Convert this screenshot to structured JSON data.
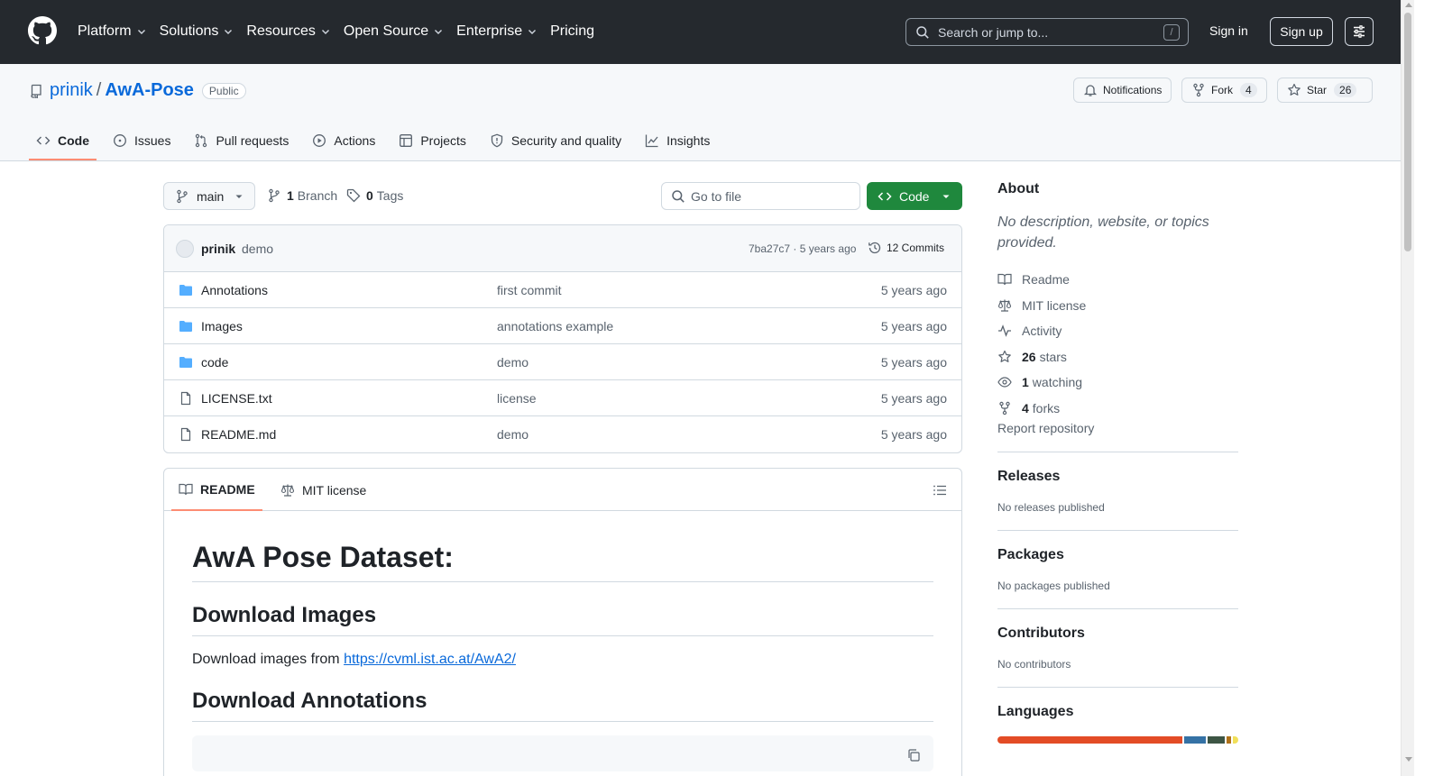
{
  "header": {
    "nav": [
      {
        "label": "Platform",
        "has_menu": true
      },
      {
        "label": "Solutions",
        "has_menu": true
      },
      {
        "label": "Resources",
        "has_menu": true
      },
      {
        "label": "Open Source",
        "has_menu": true
      },
      {
        "label": "Enterprise",
        "has_menu": true
      },
      {
        "label": "Pricing",
        "has_menu": false
      }
    ],
    "search_placeholder": "Search or jump to...",
    "search_shortcut": "/",
    "sign_in": "Sign in",
    "sign_up": "Sign up"
  },
  "repo": {
    "owner": "prinik",
    "separator": "/",
    "name": "AwA-Pose",
    "visibility": "Public",
    "notifications_label": "Notifications",
    "fork_label": "Fork",
    "fork_count": "4",
    "star_label": "Star",
    "star_count": "26",
    "tabs": [
      {
        "label": "Code",
        "icon": "code-icon",
        "active": true
      },
      {
        "label": "Issues",
        "icon": "issue-icon",
        "active": false
      },
      {
        "label": "Pull requests",
        "icon": "pull-request-icon",
        "active": false
      },
      {
        "label": "Actions",
        "icon": "play-icon",
        "active": false
      },
      {
        "label": "Projects",
        "icon": "table-icon",
        "active": false
      },
      {
        "label": "Security and quality",
        "icon": "shield-icon",
        "active": false
      },
      {
        "label": "Insights",
        "icon": "graph-icon",
        "active": false
      }
    ]
  },
  "browser": {
    "branch": "main",
    "branches_count": "1",
    "branches_label": "Branch",
    "tags_count": "0",
    "tags_label": "Tags",
    "go_to_file": "Go to file",
    "code_button": "Code",
    "commit": {
      "author": "prinik",
      "message": "demo",
      "hash_time": "7ba27c7 · 5 years ago",
      "commits_label": "12 Commits"
    },
    "files": [
      {
        "name": "Annotations",
        "type": "folder",
        "message": "first commit",
        "date": "5 years ago"
      },
      {
        "name": "Images",
        "type": "folder",
        "message": "annotations example",
        "date": "5 years ago"
      },
      {
        "name": "code",
        "type": "folder",
        "message": "demo",
        "date": "5 years ago"
      },
      {
        "name": "LICENSE.txt",
        "type": "file",
        "message": "license",
        "date": "5 years ago"
      },
      {
        "name": "README.md",
        "type": "file",
        "message": "demo",
        "date": "5 years ago"
      }
    ]
  },
  "readme": {
    "tab_readme": "README",
    "tab_license": "MIT license",
    "h1": "AwA Pose Dataset:",
    "h2_images": "Download Images",
    "p_images_prefix": "Download images from",
    "p_images_link": "https://cvml.ist.ac.at/AwA2/",
    "h2_annotations": "Download Annotations"
  },
  "sidebar": {
    "about_title": "About",
    "about_desc": "No description, website, or topics provided.",
    "links": {
      "readme": "Readme",
      "license": "MIT license",
      "activity": "Activity",
      "stars_count": "26",
      "stars_label": "stars",
      "watching_count": "1",
      "watching_label": "watching",
      "forks_count": "4",
      "forks_label": "forks"
    },
    "report": "Report repository",
    "releases_title": "Releases",
    "releases_none": "No releases published",
    "packages_title": "Packages",
    "packages_none": "No packages published",
    "contributors_title": "Contributors",
    "contributors_none": "No contributors",
    "languages_title": "Languages",
    "language_colors": [
      "#e34c26",
      "#3572a5",
      "#3d5544",
      "#b07219",
      "#f1e05a"
    ],
    "language_shares": [
      0.792,
      0.093,
      0.071,
      0.022,
      0.022
    ]
  }
}
